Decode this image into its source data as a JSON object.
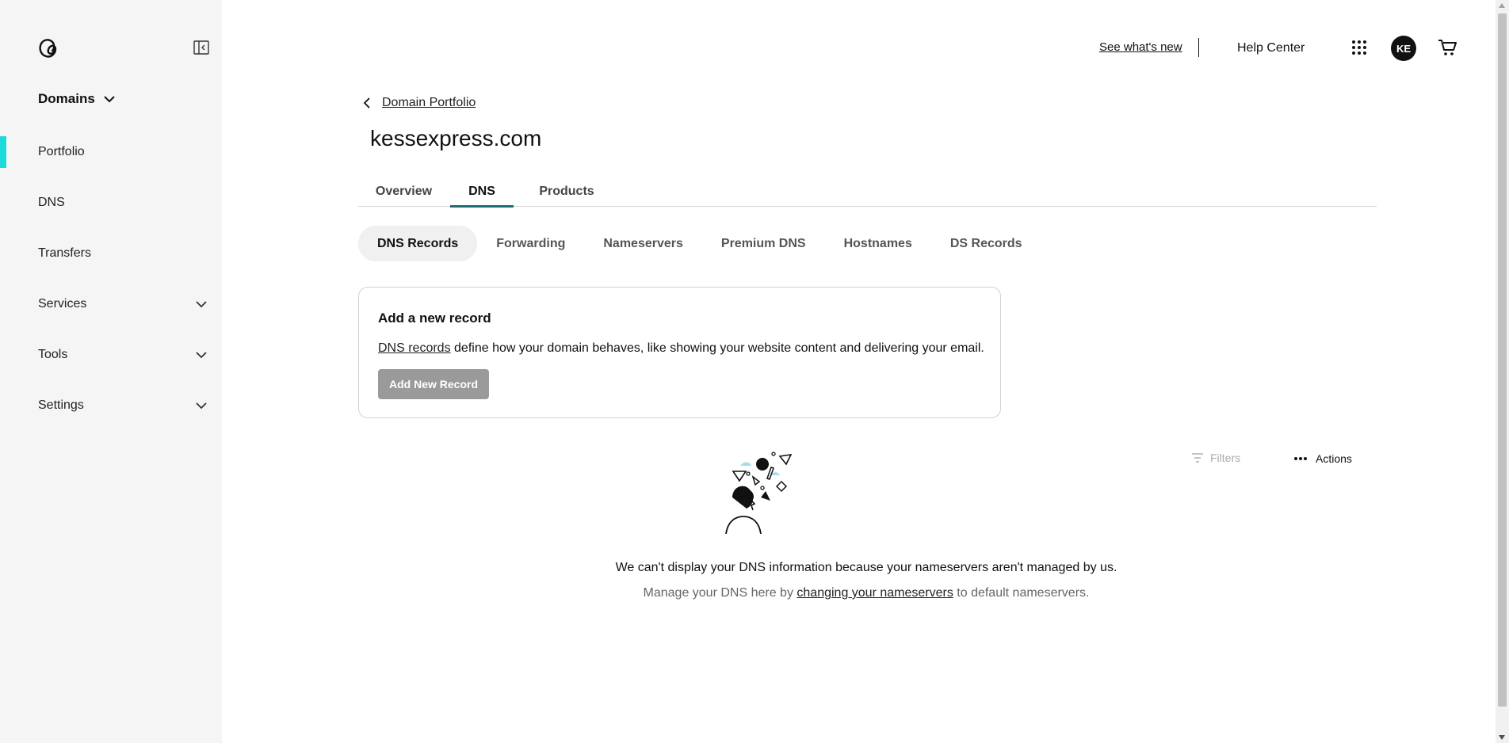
{
  "sidebar": {
    "domains_label": "Domains",
    "items": [
      {
        "label": "Portfolio",
        "active": true
      },
      {
        "label": "DNS"
      },
      {
        "label": "Transfers"
      },
      {
        "label": "Services",
        "expandable": true
      },
      {
        "label": "Tools",
        "expandable": true
      },
      {
        "label": "Settings",
        "expandable": true
      }
    ],
    "accent_color": "#1bdbdb"
  },
  "topbar": {
    "whats_new": "See what's new",
    "help_center": "Help Center",
    "avatar_initials": "KE"
  },
  "breadcrumb": {
    "label": "Domain Portfolio"
  },
  "page": {
    "title": "kessexpress.com"
  },
  "tabs": [
    {
      "label": "Overview"
    },
    {
      "label": "DNS",
      "active": true
    },
    {
      "label": "Products"
    }
  ],
  "subtabs": [
    {
      "label": "DNS Records",
      "active": true
    },
    {
      "label": "Forwarding"
    },
    {
      "label": "Nameservers"
    },
    {
      "label": "Premium DNS"
    },
    {
      "label": "Hostnames"
    },
    {
      "label": "DS Records"
    }
  ],
  "card": {
    "title": "Add a new record",
    "desc_link": "DNS records",
    "desc_rest": " define how your domain behaves, like showing your website content and delivering your email.",
    "button": "Add New Record"
  },
  "toolbar": {
    "filters": "Filters",
    "actions": "Actions"
  },
  "empty_state": {
    "line1": "We can't display your DNS information because your nameservers aren't managed by us.",
    "line2_pre": "Manage your DNS here by ",
    "line2_link": "changing your nameservers",
    "line2_post": " to default nameservers."
  },
  "icons": [
    "godaddy-logo-icon",
    "collapse-sidebar-icon",
    "chevron-down-icon",
    "apps-grid-icon",
    "cart-icon",
    "back-arrow-icon",
    "filter-icon",
    "more-dots-icon"
  ]
}
